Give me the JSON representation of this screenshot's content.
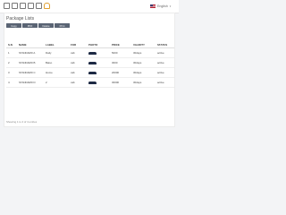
{
  "topbar": {
    "icons": [
      "window-icon",
      "window-icon",
      "refresh-icon",
      "lock-icon",
      "grid-icon",
      "bell-icon"
    ],
    "language": "English",
    "language_flag": "us-flag-icon"
  },
  "page": {
    "title": "Package Lists"
  },
  "export_buttons": [
    "Copy",
    "PDF",
    "Delete",
    "Print"
  ],
  "table": {
    "columns": [
      "S.N",
      "NAME",
      "LABEL",
      "FOR",
      "PHOTO",
      "PRICE",
      "VALIDITY",
      "STATUS"
    ],
    "rows": [
      [
        "1",
        "STANDARD A",
        "Daily",
        "cab",
        "car",
        "5000",
        "30days",
        "active"
      ],
      [
        "2",
        "STANDARD B",
        "Baiso",
        "cab",
        "car",
        "3000",
        "30days",
        "active"
      ],
      [
        "3",
        "STANDARD C",
        "Home",
        "cab",
        "car",
        "20000",
        "30days",
        "active"
      ],
      [
        "4",
        "STANDARD D",
        "2",
        "cab",
        "car",
        "30000",
        "30days",
        "active"
      ]
    ]
  },
  "footer": {
    "info": "Showing 1 to 4 of 4 entries"
  }
}
